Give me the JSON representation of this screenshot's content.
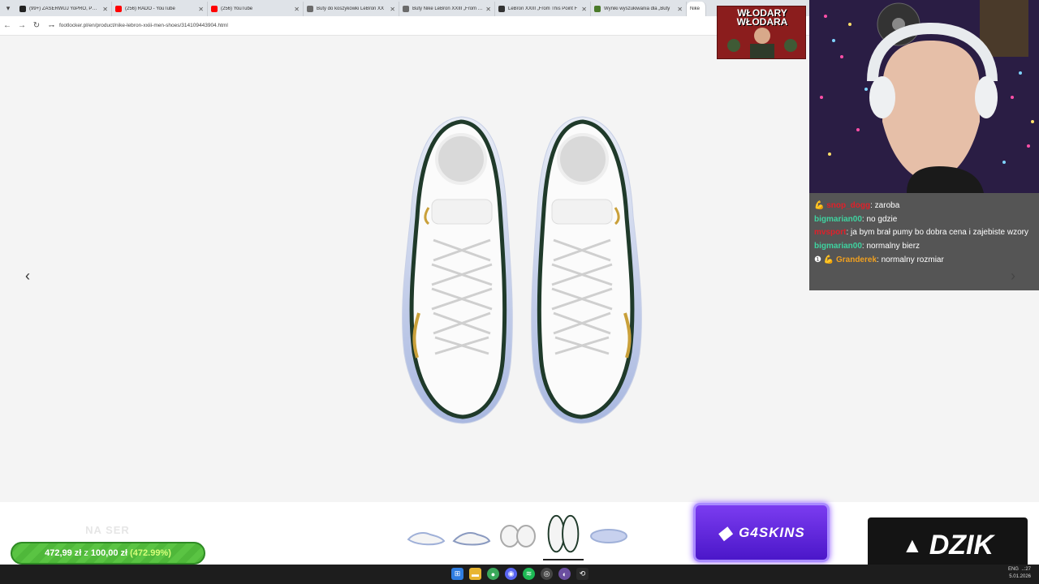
{
  "browser": {
    "tabs": [
      {
        "title": "(99+) ZASERWUJ YoPRO, PEŁNE",
        "color": "#222222"
      },
      {
        "title": "(256) RADO - YouTube",
        "color": "#ff0000"
      },
      {
        "title": "(256) YouTube",
        "color": "#ff0000"
      },
      {
        "title": "Buty do koszykówki LeBron XX",
        "color": "#6b6b6b"
      },
      {
        "title": "Buty Nike LeBron XXIII „From Th",
        "color": "#6b6b6b"
      },
      {
        "title": "LeBron XXIII „From This Point F",
        "color": "#333333"
      },
      {
        "title": "Wyniki wyszukiwania dla „Buty",
        "color": "#4a7a2a"
      },
      {
        "title": "Nike",
        "color": "#111111"
      }
    ],
    "url": "footlocker.pl/en/product/nike-lebron-xxiii-men-shoes/314109443904.html"
  },
  "overlay": {
    "emote_title_line1": "WŁODARY",
    "emote_title_line2": "WŁODARA",
    "goal_label": "NA SER",
    "goal_current": "472,99 zł",
    "goal_sep": "z",
    "goal_target": "100,00 zł",
    "goal_pct": "(472.99%)",
    "sponsor1": "G4SKINS",
    "sponsor2": "DZIK"
  },
  "chat": [
    {
      "user": "snop_dogg",
      "user_color": "#e0202a",
      "badge": "💪",
      "message": ": zaroba"
    },
    {
      "user": "bigmarian00",
      "user_color": "#3fd3a0",
      "badge": "",
      "message": ": no gdzie"
    },
    {
      "user": "mvsport",
      "user_color": "#e0202a",
      "badge": "",
      "message": ": ja bym brał pumy bo dobra cena i zajebiste wzory"
    },
    {
      "user": "bigmarian00",
      "user_color": "#3fd3a0",
      "badge": "",
      "message": ": normalny bierz"
    },
    {
      "user": "Granderek",
      "user_color": "#f0a020",
      "badge": "❶ 💪",
      "message": ": normalny rozmiar"
    }
  ],
  "product": {
    "prev_label": "‹",
    "next_label": "›",
    "thumbnails": [
      "side view",
      "side view alt",
      "front pair",
      "top view",
      "sole"
    ],
    "active_thumbnail": 3
  },
  "taskbar": {
    "time": "..:27",
    "date": "5.01.2026",
    "lang": "ENG"
  }
}
